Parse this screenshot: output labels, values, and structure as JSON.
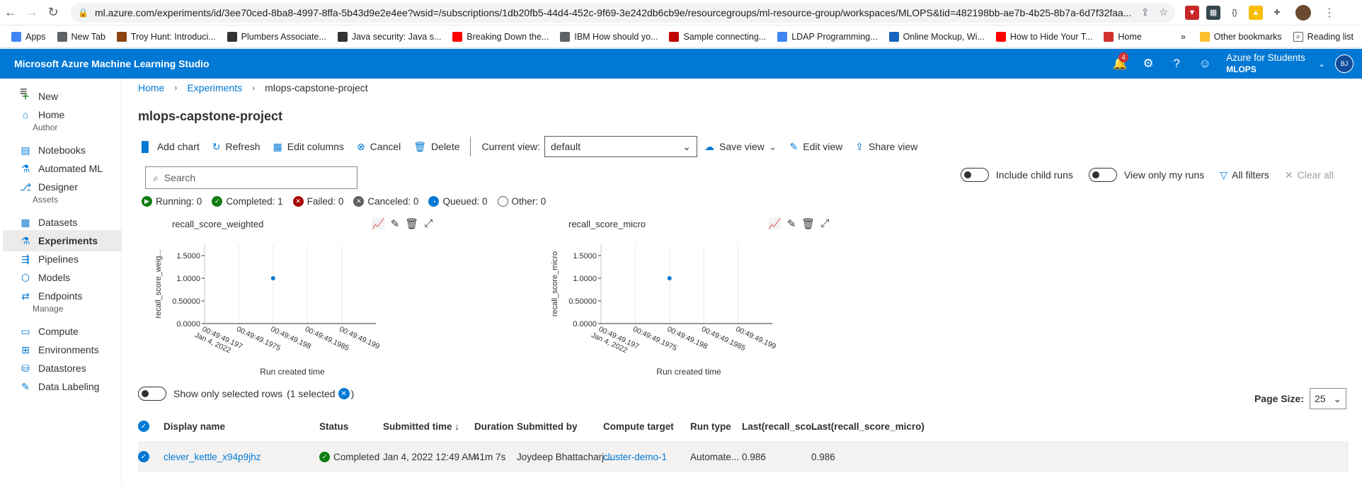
{
  "browser": {
    "url": "ml.azure.com/experiments/id/3ee70ced-8ba8-4997-8ffa-5b43d9e2e4ee?wsid=/subscriptions/1db20fb5-44d4-452c-9f69-3e242db6cb9e/resourcegroups/ml-resource-group/workspaces/MLOPS&tid=482198bb-ae7b-4b25-8b7a-6d7f32faa...",
    "bookmarks": [
      {
        "label": "Apps",
        "color": "#4285f4"
      },
      {
        "label": "New Tab",
        "color": "#5f6368"
      },
      {
        "label": "Troy Hunt: Introduci...",
        "color": "#8b4513"
      },
      {
        "label": "Plumbers Associate...",
        "color": "#333333"
      },
      {
        "label": "Java security: Java s...",
        "color": "#333333"
      },
      {
        "label": "Breaking Down the...",
        "color": "#ff0000"
      },
      {
        "label": "IBM How should yo...",
        "color": "#5f6368"
      },
      {
        "label": "Sample connecting...",
        "color": "#c00000"
      },
      {
        "label": "LDAP Programming...",
        "color": "#4285f4"
      },
      {
        "label": "Online Mockup, Wi...",
        "color": "#1565c0"
      },
      {
        "label": "How to Hide Your T...",
        "color": "#ff0000"
      },
      {
        "label": "Home",
        "color": "#d32f2f"
      }
    ],
    "other_bookmarks": "Other bookmarks",
    "reading_list": "Reading list",
    "more_bookmarks": "»"
  },
  "header": {
    "title": "Microsoft Azure Machine Learning Studio",
    "notification_count": "4",
    "workspace_top": "Azure for Students",
    "workspace_bottom": "MLOPS",
    "user_initials": "BJ",
    "accent": "#0078d4"
  },
  "sidebar": {
    "items": [
      {
        "label": "New",
        "icon": "plus-icon"
      },
      {
        "label": "Home",
        "icon": "home-icon"
      },
      {
        "label": "Notebooks",
        "icon": "notebook-icon"
      },
      {
        "label": "Automated ML",
        "icon": "automl-icon"
      },
      {
        "label": "Designer",
        "icon": "designer-icon"
      },
      {
        "label": "Datasets",
        "icon": "datasets-icon"
      },
      {
        "label": "Experiments",
        "icon": "flask-icon"
      },
      {
        "label": "Pipelines",
        "icon": "pipelines-icon"
      },
      {
        "label": "Models",
        "icon": "models-icon"
      },
      {
        "label": "Endpoints",
        "icon": "endpoints-icon"
      },
      {
        "label": "Compute",
        "icon": "compute-icon"
      },
      {
        "label": "Environments",
        "icon": "environments-icon"
      },
      {
        "label": "Datastores",
        "icon": "datastores-icon"
      },
      {
        "label": "Data Labeling",
        "icon": "labeling-icon"
      }
    ],
    "sections": [
      "Author",
      "Assets",
      "Manage"
    ]
  },
  "breadcrumb": [
    "Home",
    "Experiments",
    "mlops-capstone-project"
  ],
  "page_title": "mlops-capstone-project",
  "toolbar": {
    "add_chart": "Add chart",
    "refresh": "Refresh",
    "edit_columns": "Edit columns",
    "cancel": "Cancel",
    "delete": "Delete",
    "current_view_label": "Current view:",
    "current_view_value": "default",
    "save_view": "Save view",
    "edit_view": "Edit view",
    "share_view": "Share view"
  },
  "search": {
    "placeholder": "Search"
  },
  "filters": {
    "include_child_runs": "Include child runs",
    "view_only_my_runs": "View only my runs",
    "all_filters": "All filters",
    "clear_all": "Clear all"
  },
  "status_counts": {
    "running": "Running: 0",
    "completed": "Completed: 1",
    "failed": "Failed: 0",
    "canceled": "Canceled: 0",
    "queued": "Queued: 0",
    "other": "Other: 0"
  },
  "chart_data": [
    {
      "type": "scatter",
      "title": "recall_score_weighted",
      "ylabel": "recall_score_weig...",
      "xlabel": "Run created time",
      "y_ticks": [
        "0.0000",
        "0.50000",
        "1.0000",
        "1.5000"
      ],
      "ylim": [
        0,
        1.75
      ],
      "x_ticks": [
        [
          "00:49:49.197",
          "Jan 4, 2022"
        ],
        [
          "00:49:49.1975"
        ],
        [
          "00:49:49.198"
        ],
        [
          "00:49:49.1985"
        ],
        [
          "00:49:49.199"
        ]
      ],
      "points": [
        {
          "x": "00:49:49.198",
          "y": 1.0
        }
      ],
      "color": "#0078d4"
    },
    {
      "type": "scatter",
      "title": "recall_score_micro",
      "ylabel": "recall_score_micro",
      "xlabel": "Run created time",
      "y_ticks": [
        "0.0000",
        "0.50000",
        "1.0000",
        "1.5000"
      ],
      "ylim": [
        0,
        1.75
      ],
      "x_ticks": [
        [
          "00:49:49.197",
          "Jan 4, 2022"
        ],
        [
          "00:49:49.1975"
        ],
        [
          "00:49:49.198"
        ],
        [
          "00:49:49.1985"
        ],
        [
          "00:49:49.199"
        ]
      ],
      "points": [
        {
          "x": "00:49:49.198",
          "y": 1.0
        }
      ],
      "color": "#0078d4"
    }
  ],
  "table": {
    "show_selected_label": "Show only selected rows",
    "selected_count": "(1 selected",
    "selected_close": ")",
    "page_size_label": "Page Size:",
    "page_size_value": "25",
    "columns": [
      "Display name",
      "Status",
      "Submitted time ↓",
      "Duration",
      "Submitted by",
      "Compute target",
      "Run type",
      "Last(recall_sco...",
      "Last(recall_score_micro)"
    ],
    "rows": [
      {
        "display_name": "clever_kettle_x94p9jhz",
        "status": "Completed",
        "submitted_time": "Jan 4, 2022 12:49 AM",
        "duration": "41m 7s",
        "submitted_by": "Joydeep Bhattacharj...",
        "compute_target": "cluster-demo-1",
        "run_type": "Automate...",
        "last_recall_weighted": "0.986",
        "last_recall_micro": "0.986"
      }
    ]
  }
}
